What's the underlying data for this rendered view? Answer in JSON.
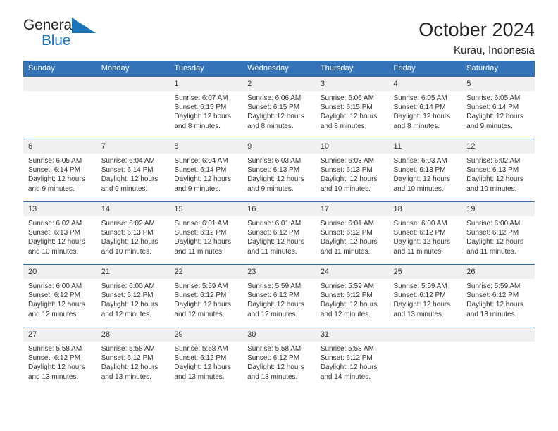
{
  "brand": {
    "name_top": "General",
    "name_bottom": "Blue",
    "color_dark": "#231f20",
    "color_blue": "#1b75bb",
    "triangle_icon": "triangle-icon"
  },
  "header": {
    "title": "October 2024",
    "subtitle": "Kurau, Indonesia"
  },
  "theme": {
    "header_bg": "#3573b9",
    "header_text": "#ffffff",
    "grid_line": "#2e6da4",
    "daynum_bg": "#f0f0f0",
    "cell_bg": "#ffffff",
    "body_text": "#333333"
  },
  "labels": {
    "sunrise": "Sunrise:",
    "sunset": "Sunset:",
    "daylight": "Daylight:"
  },
  "weekday_headers": [
    "Sunday",
    "Monday",
    "Tuesday",
    "Wednesday",
    "Thursday",
    "Friday",
    "Saturday"
  ],
  "weeks": [
    [
      {
        "day": "",
        "sunrise": "",
        "sunset": "",
        "daylight_line1": "",
        "daylight_line2": ""
      },
      {
        "day": "",
        "sunrise": "",
        "sunset": "",
        "daylight_line1": "",
        "daylight_line2": ""
      },
      {
        "day": "1",
        "sunrise": "Sunrise: 6:07 AM",
        "sunset": "Sunset: 6:15 PM",
        "daylight_line1": "Daylight: 12 hours",
        "daylight_line2": "and 8 minutes."
      },
      {
        "day": "2",
        "sunrise": "Sunrise: 6:06 AM",
        "sunset": "Sunset: 6:15 PM",
        "daylight_line1": "Daylight: 12 hours",
        "daylight_line2": "and 8 minutes."
      },
      {
        "day": "3",
        "sunrise": "Sunrise: 6:06 AM",
        "sunset": "Sunset: 6:15 PM",
        "daylight_line1": "Daylight: 12 hours",
        "daylight_line2": "and 8 minutes."
      },
      {
        "day": "4",
        "sunrise": "Sunrise: 6:05 AM",
        "sunset": "Sunset: 6:14 PM",
        "daylight_line1": "Daylight: 12 hours",
        "daylight_line2": "and 8 minutes."
      },
      {
        "day": "5",
        "sunrise": "Sunrise: 6:05 AM",
        "sunset": "Sunset: 6:14 PM",
        "daylight_line1": "Daylight: 12 hours",
        "daylight_line2": "and 9 minutes."
      }
    ],
    [
      {
        "day": "6",
        "sunrise": "Sunrise: 6:05 AM",
        "sunset": "Sunset: 6:14 PM",
        "daylight_line1": "Daylight: 12 hours",
        "daylight_line2": "and 9 minutes."
      },
      {
        "day": "7",
        "sunrise": "Sunrise: 6:04 AM",
        "sunset": "Sunset: 6:14 PM",
        "daylight_line1": "Daylight: 12 hours",
        "daylight_line2": "and 9 minutes."
      },
      {
        "day": "8",
        "sunrise": "Sunrise: 6:04 AM",
        "sunset": "Sunset: 6:14 PM",
        "daylight_line1": "Daylight: 12 hours",
        "daylight_line2": "and 9 minutes."
      },
      {
        "day": "9",
        "sunrise": "Sunrise: 6:03 AM",
        "sunset": "Sunset: 6:13 PM",
        "daylight_line1": "Daylight: 12 hours",
        "daylight_line2": "and 9 minutes."
      },
      {
        "day": "10",
        "sunrise": "Sunrise: 6:03 AM",
        "sunset": "Sunset: 6:13 PM",
        "daylight_line1": "Daylight: 12 hours",
        "daylight_line2": "and 10 minutes."
      },
      {
        "day": "11",
        "sunrise": "Sunrise: 6:03 AM",
        "sunset": "Sunset: 6:13 PM",
        "daylight_line1": "Daylight: 12 hours",
        "daylight_line2": "and 10 minutes."
      },
      {
        "day": "12",
        "sunrise": "Sunrise: 6:02 AM",
        "sunset": "Sunset: 6:13 PM",
        "daylight_line1": "Daylight: 12 hours",
        "daylight_line2": "and 10 minutes."
      }
    ],
    [
      {
        "day": "13",
        "sunrise": "Sunrise: 6:02 AM",
        "sunset": "Sunset: 6:13 PM",
        "daylight_line1": "Daylight: 12 hours",
        "daylight_line2": "and 10 minutes."
      },
      {
        "day": "14",
        "sunrise": "Sunrise: 6:02 AM",
        "sunset": "Sunset: 6:13 PM",
        "daylight_line1": "Daylight: 12 hours",
        "daylight_line2": "and 10 minutes."
      },
      {
        "day": "15",
        "sunrise": "Sunrise: 6:01 AM",
        "sunset": "Sunset: 6:12 PM",
        "daylight_line1": "Daylight: 12 hours",
        "daylight_line2": "and 11 minutes."
      },
      {
        "day": "16",
        "sunrise": "Sunrise: 6:01 AM",
        "sunset": "Sunset: 6:12 PM",
        "daylight_line1": "Daylight: 12 hours",
        "daylight_line2": "and 11 minutes."
      },
      {
        "day": "17",
        "sunrise": "Sunrise: 6:01 AM",
        "sunset": "Sunset: 6:12 PM",
        "daylight_line1": "Daylight: 12 hours",
        "daylight_line2": "and 11 minutes."
      },
      {
        "day": "18",
        "sunrise": "Sunrise: 6:00 AM",
        "sunset": "Sunset: 6:12 PM",
        "daylight_line1": "Daylight: 12 hours",
        "daylight_line2": "and 11 minutes."
      },
      {
        "day": "19",
        "sunrise": "Sunrise: 6:00 AM",
        "sunset": "Sunset: 6:12 PM",
        "daylight_line1": "Daylight: 12 hours",
        "daylight_line2": "and 11 minutes."
      }
    ],
    [
      {
        "day": "20",
        "sunrise": "Sunrise: 6:00 AM",
        "sunset": "Sunset: 6:12 PM",
        "daylight_line1": "Daylight: 12 hours",
        "daylight_line2": "and 12 minutes."
      },
      {
        "day": "21",
        "sunrise": "Sunrise: 6:00 AM",
        "sunset": "Sunset: 6:12 PM",
        "daylight_line1": "Daylight: 12 hours",
        "daylight_line2": "and 12 minutes."
      },
      {
        "day": "22",
        "sunrise": "Sunrise: 5:59 AM",
        "sunset": "Sunset: 6:12 PM",
        "daylight_line1": "Daylight: 12 hours",
        "daylight_line2": "and 12 minutes."
      },
      {
        "day": "23",
        "sunrise": "Sunrise: 5:59 AM",
        "sunset": "Sunset: 6:12 PM",
        "daylight_line1": "Daylight: 12 hours",
        "daylight_line2": "and 12 minutes."
      },
      {
        "day": "24",
        "sunrise": "Sunrise: 5:59 AM",
        "sunset": "Sunset: 6:12 PM",
        "daylight_line1": "Daylight: 12 hours",
        "daylight_line2": "and 12 minutes."
      },
      {
        "day": "25",
        "sunrise": "Sunrise: 5:59 AM",
        "sunset": "Sunset: 6:12 PM",
        "daylight_line1": "Daylight: 12 hours",
        "daylight_line2": "and 13 minutes."
      },
      {
        "day": "26",
        "sunrise": "Sunrise: 5:59 AM",
        "sunset": "Sunset: 6:12 PM",
        "daylight_line1": "Daylight: 12 hours",
        "daylight_line2": "and 13 minutes."
      }
    ],
    [
      {
        "day": "27",
        "sunrise": "Sunrise: 5:58 AM",
        "sunset": "Sunset: 6:12 PM",
        "daylight_line1": "Daylight: 12 hours",
        "daylight_line2": "and 13 minutes."
      },
      {
        "day": "28",
        "sunrise": "Sunrise: 5:58 AM",
        "sunset": "Sunset: 6:12 PM",
        "daylight_line1": "Daylight: 12 hours",
        "daylight_line2": "and 13 minutes."
      },
      {
        "day": "29",
        "sunrise": "Sunrise: 5:58 AM",
        "sunset": "Sunset: 6:12 PM",
        "daylight_line1": "Daylight: 12 hours",
        "daylight_line2": "and 13 minutes."
      },
      {
        "day": "30",
        "sunrise": "Sunrise: 5:58 AM",
        "sunset": "Sunset: 6:12 PM",
        "daylight_line1": "Daylight: 12 hours",
        "daylight_line2": "and 13 minutes."
      },
      {
        "day": "31",
        "sunrise": "Sunrise: 5:58 AM",
        "sunset": "Sunset: 6:12 PM",
        "daylight_line1": "Daylight: 12 hours",
        "daylight_line2": "and 14 minutes."
      },
      {
        "day": "",
        "sunrise": "",
        "sunset": "",
        "daylight_line1": "",
        "daylight_line2": ""
      },
      {
        "day": "",
        "sunrise": "",
        "sunset": "",
        "daylight_line1": "",
        "daylight_line2": ""
      }
    ]
  ]
}
